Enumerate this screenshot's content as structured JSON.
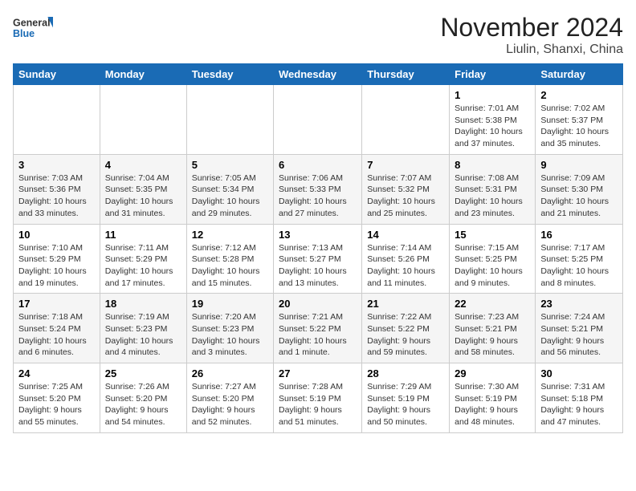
{
  "logo": {
    "line1": "General",
    "line2": "Blue"
  },
  "title": "November 2024",
  "location": "Liulin, Shanxi, China",
  "weekdays": [
    "Sunday",
    "Monday",
    "Tuesday",
    "Wednesday",
    "Thursday",
    "Friday",
    "Saturday"
  ],
  "weeks": [
    [
      {
        "day": "",
        "detail": ""
      },
      {
        "day": "",
        "detail": ""
      },
      {
        "day": "",
        "detail": ""
      },
      {
        "day": "",
        "detail": ""
      },
      {
        "day": "",
        "detail": ""
      },
      {
        "day": "1",
        "detail": "Sunrise: 7:01 AM\nSunset: 5:38 PM\nDaylight: 10 hours\nand 37 minutes."
      },
      {
        "day": "2",
        "detail": "Sunrise: 7:02 AM\nSunset: 5:37 PM\nDaylight: 10 hours\nand 35 minutes."
      }
    ],
    [
      {
        "day": "3",
        "detail": "Sunrise: 7:03 AM\nSunset: 5:36 PM\nDaylight: 10 hours\nand 33 minutes."
      },
      {
        "day": "4",
        "detail": "Sunrise: 7:04 AM\nSunset: 5:35 PM\nDaylight: 10 hours\nand 31 minutes."
      },
      {
        "day": "5",
        "detail": "Sunrise: 7:05 AM\nSunset: 5:34 PM\nDaylight: 10 hours\nand 29 minutes."
      },
      {
        "day": "6",
        "detail": "Sunrise: 7:06 AM\nSunset: 5:33 PM\nDaylight: 10 hours\nand 27 minutes."
      },
      {
        "day": "7",
        "detail": "Sunrise: 7:07 AM\nSunset: 5:32 PM\nDaylight: 10 hours\nand 25 minutes."
      },
      {
        "day": "8",
        "detail": "Sunrise: 7:08 AM\nSunset: 5:31 PM\nDaylight: 10 hours\nand 23 minutes."
      },
      {
        "day": "9",
        "detail": "Sunrise: 7:09 AM\nSunset: 5:30 PM\nDaylight: 10 hours\nand 21 minutes."
      }
    ],
    [
      {
        "day": "10",
        "detail": "Sunrise: 7:10 AM\nSunset: 5:29 PM\nDaylight: 10 hours\nand 19 minutes."
      },
      {
        "day": "11",
        "detail": "Sunrise: 7:11 AM\nSunset: 5:29 PM\nDaylight: 10 hours\nand 17 minutes."
      },
      {
        "day": "12",
        "detail": "Sunrise: 7:12 AM\nSunset: 5:28 PM\nDaylight: 10 hours\nand 15 minutes."
      },
      {
        "day": "13",
        "detail": "Sunrise: 7:13 AM\nSunset: 5:27 PM\nDaylight: 10 hours\nand 13 minutes."
      },
      {
        "day": "14",
        "detail": "Sunrise: 7:14 AM\nSunset: 5:26 PM\nDaylight: 10 hours\nand 11 minutes."
      },
      {
        "day": "15",
        "detail": "Sunrise: 7:15 AM\nSunset: 5:25 PM\nDaylight: 10 hours\nand 9 minutes."
      },
      {
        "day": "16",
        "detail": "Sunrise: 7:17 AM\nSunset: 5:25 PM\nDaylight: 10 hours\nand 8 minutes."
      }
    ],
    [
      {
        "day": "17",
        "detail": "Sunrise: 7:18 AM\nSunset: 5:24 PM\nDaylight: 10 hours\nand 6 minutes."
      },
      {
        "day": "18",
        "detail": "Sunrise: 7:19 AM\nSunset: 5:23 PM\nDaylight: 10 hours\nand 4 minutes."
      },
      {
        "day": "19",
        "detail": "Sunrise: 7:20 AM\nSunset: 5:23 PM\nDaylight: 10 hours\nand 3 minutes."
      },
      {
        "day": "20",
        "detail": "Sunrise: 7:21 AM\nSunset: 5:22 PM\nDaylight: 10 hours\nand 1 minute."
      },
      {
        "day": "21",
        "detail": "Sunrise: 7:22 AM\nSunset: 5:22 PM\nDaylight: 9 hours\nand 59 minutes."
      },
      {
        "day": "22",
        "detail": "Sunrise: 7:23 AM\nSunset: 5:21 PM\nDaylight: 9 hours\nand 58 minutes."
      },
      {
        "day": "23",
        "detail": "Sunrise: 7:24 AM\nSunset: 5:21 PM\nDaylight: 9 hours\nand 56 minutes."
      }
    ],
    [
      {
        "day": "24",
        "detail": "Sunrise: 7:25 AM\nSunset: 5:20 PM\nDaylight: 9 hours\nand 55 minutes."
      },
      {
        "day": "25",
        "detail": "Sunrise: 7:26 AM\nSunset: 5:20 PM\nDaylight: 9 hours\nand 54 minutes."
      },
      {
        "day": "26",
        "detail": "Sunrise: 7:27 AM\nSunset: 5:20 PM\nDaylight: 9 hours\nand 52 minutes."
      },
      {
        "day": "27",
        "detail": "Sunrise: 7:28 AM\nSunset: 5:19 PM\nDaylight: 9 hours\nand 51 minutes."
      },
      {
        "day": "28",
        "detail": "Sunrise: 7:29 AM\nSunset: 5:19 PM\nDaylight: 9 hours\nand 50 minutes."
      },
      {
        "day": "29",
        "detail": "Sunrise: 7:30 AM\nSunset: 5:19 PM\nDaylight: 9 hours\nand 48 minutes."
      },
      {
        "day": "30",
        "detail": "Sunrise: 7:31 AM\nSunset: 5:18 PM\nDaylight: 9 hours\nand 47 minutes."
      }
    ]
  ]
}
